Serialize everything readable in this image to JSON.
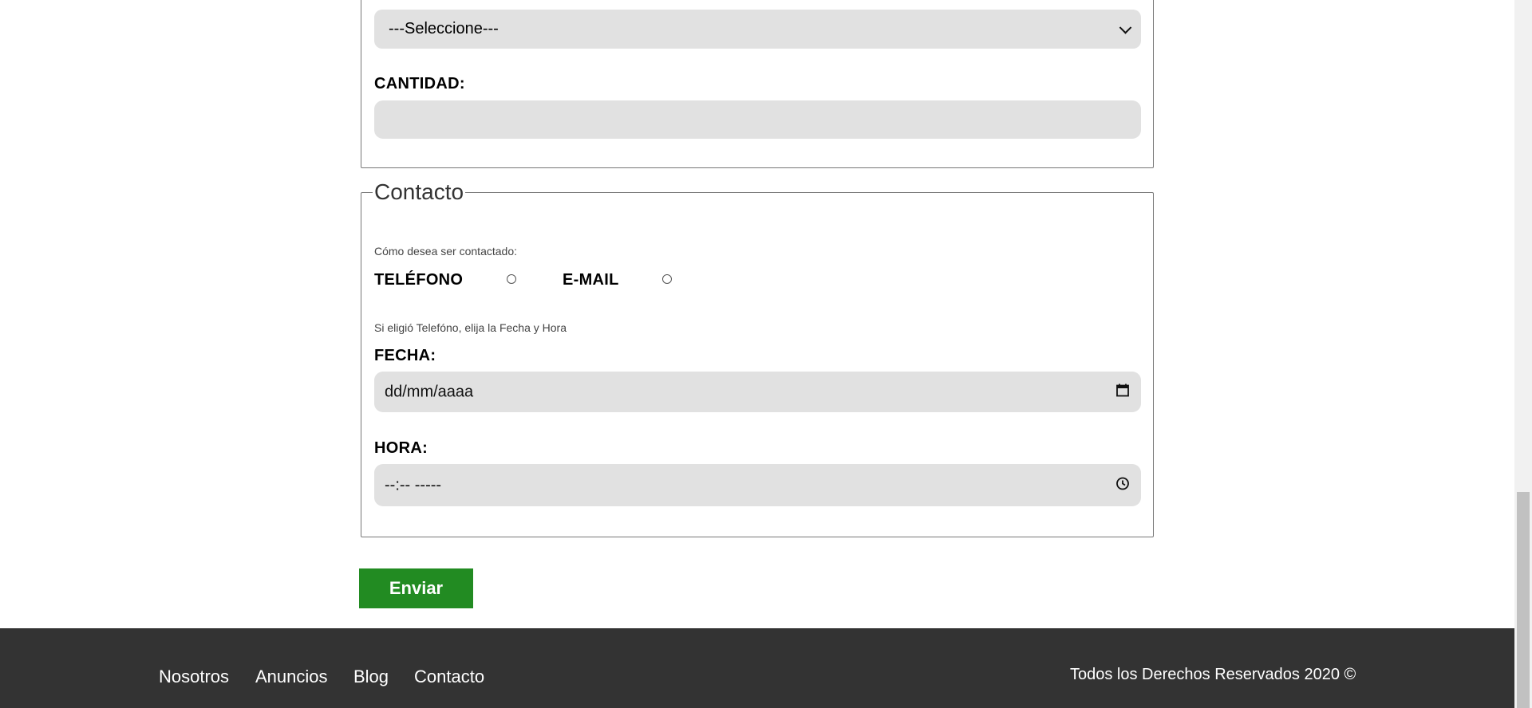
{
  "product_section": {
    "select_value": "---Seleccione---",
    "quantity_label": "CANTIDAD:",
    "quantity_value": ""
  },
  "contact_section": {
    "legend": "Contacto",
    "prompt": "Cómo desea ser contactado:",
    "phone_label": "TELÉFONO",
    "email_label": "E-MAIL",
    "phone_hint": "Si eligió Telefóno, elija la Fecha y Hora",
    "date_label": "FECHA:",
    "date_placeholder": "dd/mm/aaaa",
    "time_label": "HORA:",
    "time_placeholder": "--:-- -----"
  },
  "submit_label": "Enviar",
  "footer": {
    "nav": [
      "Nosotros",
      "Anuncios",
      "Blog",
      "Contacto"
    ],
    "copyright": "Todos los Derechos Reservados 2020 ©"
  },
  "colors": {
    "submit_bg": "#228b22",
    "footer_bg": "#333333",
    "input_bg": "#e1e1e1"
  },
  "icons": {
    "select": "chevron-down-icon",
    "date": "calendar-icon",
    "time": "clock-icon"
  }
}
